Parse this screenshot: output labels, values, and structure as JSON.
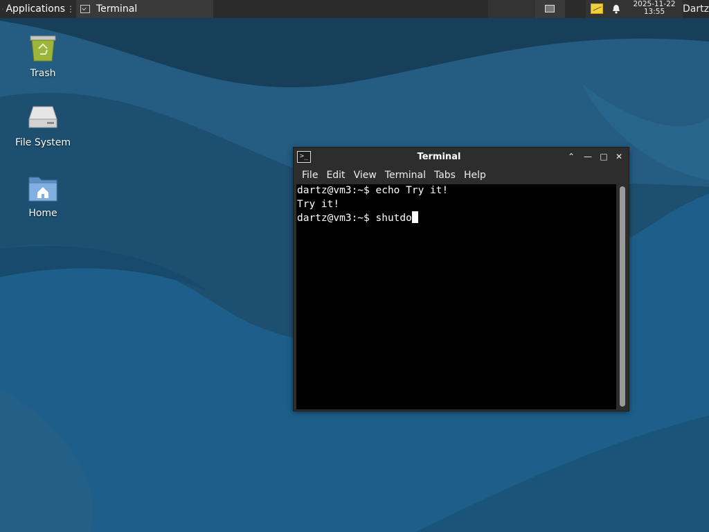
{
  "panel": {
    "applications_label": "Applications",
    "applications_separator": "⋮",
    "task_terminal_label": "Terminal",
    "clock_date": "2025-11-22",
    "clock_time": "13:55",
    "user": "Dartz"
  },
  "desktop": {
    "icons": [
      {
        "label": "Trash",
        "icon": "trash-icon"
      },
      {
        "label": "File System",
        "icon": "drive-icon"
      },
      {
        "label": "Home",
        "icon": "home-folder-icon"
      }
    ]
  },
  "terminal": {
    "title": "Terminal",
    "menu": [
      "File",
      "Edit",
      "View",
      "Terminal",
      "Tabs",
      "Help"
    ],
    "lines": [
      "dartz@vm3:~$ echo Try it!",
      "Try it!",
      "dartz@vm3:~$ shutdo"
    ]
  },
  "colors": {
    "desktop_bg": "#1f5478",
    "panel_bg": "#2b2b2b",
    "terminal_bg": "#000000",
    "window_frame": "#2d2d2d"
  }
}
